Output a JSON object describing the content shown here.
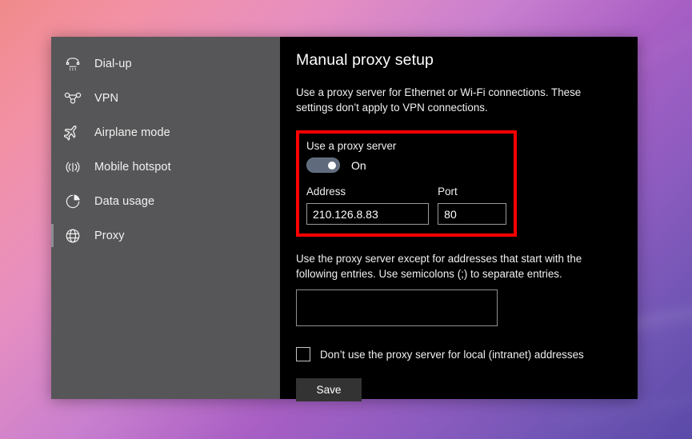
{
  "sidebar": {
    "items": [
      {
        "label": "Dial-up",
        "icon": "phone-icon",
        "selected": false
      },
      {
        "label": "VPN",
        "icon": "vpn-icon",
        "selected": false
      },
      {
        "label": "Airplane mode",
        "icon": "airplane-icon",
        "selected": false
      },
      {
        "label": "Mobile hotspot",
        "icon": "wifi-signal-icon",
        "selected": false
      },
      {
        "label": "Data usage",
        "icon": "pie-chart-icon",
        "selected": false
      },
      {
        "label": "Proxy",
        "icon": "globe-icon",
        "selected": true
      }
    ]
  },
  "content": {
    "title": "Manual proxy setup",
    "description": "Use a proxy server for Ethernet or Wi-Fi connections. These settings don’t apply to VPN connections.",
    "proxy_group": {
      "toggle_label": "Use a proxy server",
      "toggle_state": "On",
      "address_label": "Address",
      "address_value": "210.126.8.83",
      "address_placeholder": "",
      "port_label": "Port",
      "port_value": "80",
      "port_placeholder": ""
    },
    "exceptions": {
      "description": "Use the proxy server except for addresses that start with the following entries. Use semicolons (;) to separate entries.",
      "value": "",
      "placeholder": ""
    },
    "local_bypass_label": "Don’t use the proxy server for local (intranet) addresses",
    "save_label": "Save"
  },
  "colors": {
    "highlight": "#ff0000",
    "sidebar_bg": "#565658",
    "content_bg": "#000000",
    "toggle_on": "#5f6b7d",
    "save_bg": "#333333"
  }
}
